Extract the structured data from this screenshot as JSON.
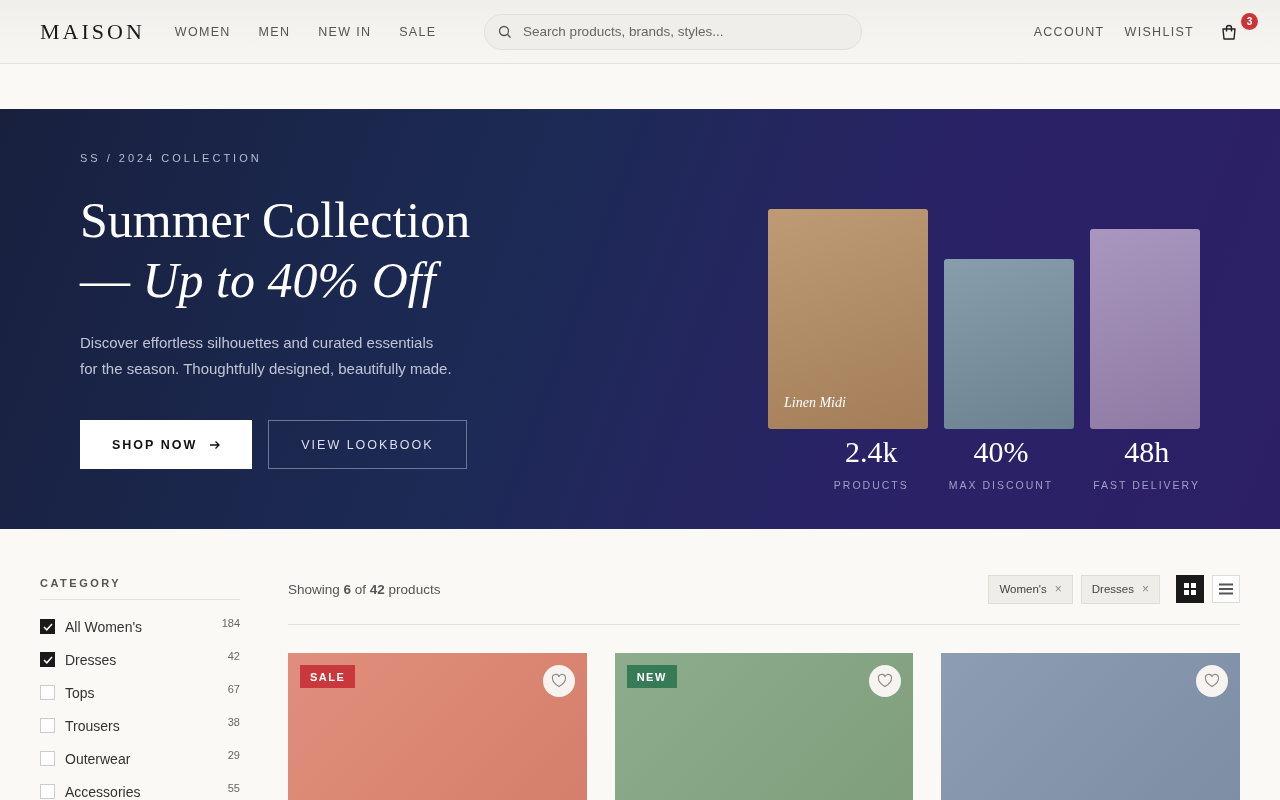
{
  "header": {
    "logo": "MAISON",
    "nav": [
      {
        "label": "WOMEN"
      },
      {
        "label": "MEN"
      },
      {
        "label": "NEW IN"
      },
      {
        "label": "SALE"
      }
    ],
    "search": {
      "placeholder": "Search products, brands, styles..."
    },
    "links": [
      {
        "label": "ACCOUNT"
      },
      {
        "label": "WISHLIST"
      }
    ],
    "cart_count": "3"
  },
  "hero": {
    "eyebrow": "SS / 2024 COLLECTION",
    "title_lines": [
      "Summer Collection",
      "— *Up to 40% Off*"
    ],
    "text": "Discover effortless silhouettes and curated essentials for the season. Thoughtfully designed, beautifully made.",
    "buttons": [
      {
        "label": "SHOP NOW",
        "kind": "primary"
      },
      {
        "label": "VIEW LOOKBOOK",
        "kind": "outline"
      }
    ],
    "swatches": [
      {
        "color": "#b58c62",
        "caption": "Linen Midi"
      },
      {
        "color": "#7890a0"
      },
      {
        "color": "#9e88b6"
      }
    ],
    "stats": [
      {
        "value": "2.4k",
        "label": "PRODUCTS"
      },
      {
        "value": "40%",
        "label": "MAX DISCOUNT"
      },
      {
        "value": "48h",
        "label": "FAST DELIVERY"
      }
    ]
  },
  "sidebar": {
    "heading": "CATEGORY",
    "items": [
      {
        "label": "All Women's",
        "count": "184",
        "checked": true
      },
      {
        "label": "Dresses",
        "count": "42",
        "checked": true
      },
      {
        "label": "Tops",
        "count": "67",
        "checked": false
      },
      {
        "label": "Trousers",
        "count": "38",
        "checked": false
      },
      {
        "label": "Outerwear",
        "count": "29",
        "checked": false
      },
      {
        "label": "Accessories",
        "count": "55",
        "checked": false
      }
    ]
  },
  "results": {
    "summary": "Showing **6** of **42** products",
    "filters": [
      {
        "label": "Women's",
        "remove": "×"
      },
      {
        "label": "Dresses",
        "remove": "×"
      }
    ],
    "views": [
      {
        "kind": "grid",
        "selected": true
      },
      {
        "kind": "list",
        "selected": false
      }
    ]
  },
  "products": [
    {
      "color": "#dc7f6a",
      "badge": {
        "text": "SALE",
        "kind": "sale"
      }
    },
    {
      "color": "#7ea17c",
      "badge": {
        "text": "NEW",
        "kind": "new"
      }
    },
    {
      "color": "#7d8fa8"
    }
  ]
}
